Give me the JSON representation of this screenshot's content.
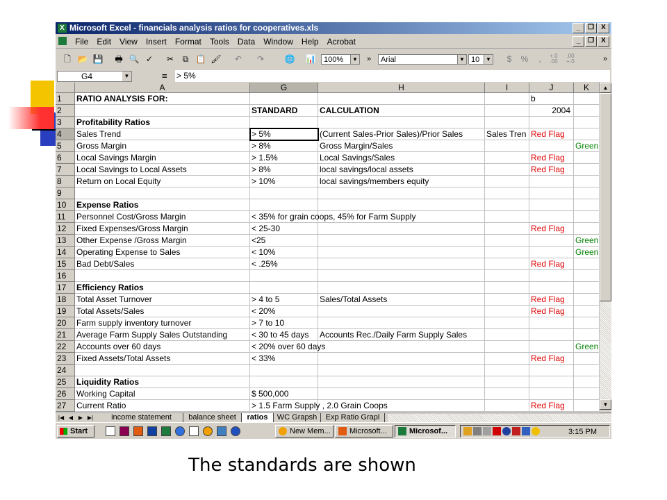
{
  "window": {
    "title": "Microsoft Excel - financials analysis ratios for cooperatives.xls",
    "app_icon": "excel-icon",
    "controls": [
      "_",
      "❐",
      "X"
    ]
  },
  "menubar": {
    "items": [
      "File",
      "Edit",
      "View",
      "Insert",
      "Format",
      "Tools",
      "Data",
      "Window",
      "Help",
      "Acrobat"
    ],
    "doc_controls": [
      "_",
      "❐",
      "X"
    ]
  },
  "toolbar": {
    "zoom": "100%",
    "font_name": "Arial",
    "font_size": "10",
    "more": "»",
    "currency": "$",
    "percent": "%",
    "comma": ",",
    "inc_decimal": "+.0\n.00",
    "dec_decimal": ".00\n+.0"
  },
  "formula_bar": {
    "name_box": "G4",
    "equals": "=",
    "value": "> 5%"
  },
  "columns": [
    {
      "label": "A",
      "selected": false
    },
    {
      "label": "G",
      "selected": true
    },
    {
      "label": "H",
      "selected": false
    },
    {
      "label": "I",
      "selected": false
    },
    {
      "label": "J",
      "selected": false
    },
    {
      "label": "K",
      "selected": false
    }
  ],
  "rows": [
    {
      "num": "1",
      "A": "RATIO ANALYSIS FOR:",
      "A_bold": true,
      "G": "",
      "H": "",
      "I": "",
      "J": "b",
      "K": ""
    },
    {
      "num": "2",
      "A": "",
      "G": "STANDARD",
      "G_bold": true,
      "H": "CALCULATION",
      "H_bold": true,
      "I": "",
      "J": "2004",
      "J_right": true,
      "K": ""
    },
    {
      "num": "3",
      "A": "Profitability Ratios",
      "A_bold": true,
      "G": "",
      "H": "",
      "I": "",
      "J": "",
      "K": ""
    },
    {
      "num": "4",
      "A": "Sales Trend",
      "G": "> 5%",
      "H": "(Current Sales-Prior Sales)/Prior Sales",
      "I": "Sales Tren",
      "J": "Red Flag",
      "J_color": "red",
      "K": ""
    },
    {
      "num": "5",
      "A": "Gross Margin",
      "G": "> 8%",
      "H": "Gross Margin/Sales",
      "I": "",
      "J": "",
      "K": "Green",
      "K_color": "green"
    },
    {
      "num": "6",
      "A": "Local Savings Margin",
      "G": "> 1.5%",
      "H": "Local Savings/Sales",
      "I": "",
      "J": "Red Flag",
      "J_color": "red",
      "K": ""
    },
    {
      "num": "7",
      "A": "Local Savings to Local Assets",
      "G": "> 8%",
      "H": "local savings/local assets",
      "I": "",
      "J": "Red Flag",
      "J_color": "red",
      "K": ""
    },
    {
      "num": "8",
      "A": "Return on Local Equity",
      "G": "> 10%",
      "H": "local savings/members equity",
      "I": "",
      "J": "",
      "K": ""
    },
    {
      "num": "9",
      "A": "",
      "G": "",
      "H": "",
      "I": "",
      "J": "",
      "K": ""
    },
    {
      "num": "10",
      "A": "Expense Ratios",
      "A_bold": true,
      "G": "",
      "H": "",
      "I": "",
      "J": "",
      "K": ""
    },
    {
      "num": "11",
      "A": "Personnel Cost/Gross Margin",
      "G": "< 35% for grain coops, 45% for Farm Supply",
      "G_overflow": true,
      "H": "",
      "I": "",
      "J": "",
      "K": ""
    },
    {
      "num": "12",
      "A": "Fixed Expenses/Gross Margin",
      "G": "< 25-30",
      "H": "",
      "I": "",
      "J": "Red Flag",
      "J_color": "red",
      "K": ""
    },
    {
      "num": "13",
      "A": "Other Expense /Gross Margin",
      "G": "<25",
      "H": "",
      "I": "",
      "J": "",
      "K": "Green",
      "K_color": "green"
    },
    {
      "num": "14",
      "A": "Operating Expense to Sales",
      "G": "< 10%",
      "H": "",
      "I": "",
      "J": "",
      "K": "Green",
      "K_color": "green"
    },
    {
      "num": "15",
      "A": "Bad Debt/Sales",
      "G": "< .25%",
      "H": "",
      "I": "",
      "J": "Red Flag",
      "J_color": "red",
      "K": ""
    },
    {
      "num": "16",
      "A": "",
      "G": "",
      "H": "",
      "I": "",
      "J": "",
      "K": ""
    },
    {
      "num": "17",
      "A": "Efficiency Ratios",
      "A_bold": true,
      "G": "",
      "H": "",
      "I": "",
      "J": "",
      "K": ""
    },
    {
      "num": "18",
      "A": "Total Asset Turnover",
      "G": " > 4 to 5",
      "H": "Sales/Total Assets",
      "I": "",
      "J": "Red Flag",
      "J_color": "red",
      "K": ""
    },
    {
      "num": "19",
      "A": "Total Assets/Sales",
      "G": "< 20%",
      "H": "",
      "I": "",
      "J": "Red Flag",
      "J_color": "red",
      "K": ""
    },
    {
      "num": "20",
      "A": "Farm supply inventory turnover",
      "G": "> 7 to 10",
      "H": "",
      "I": "",
      "J": "",
      "K": ""
    },
    {
      "num": "21",
      "A": "Average Farm Supply Sales Outstanding",
      "G": "< 30 to 45 days",
      "H": "Accounts Rec./Daily Farm Supply Sales",
      "I": "",
      "J": "",
      "K": ""
    },
    {
      "num": "22",
      "A": "Accounts over 60 days",
      "G": "< 20% over 60 days",
      "G_overflow": true,
      "H": "",
      "I": "",
      "J": "",
      "K": "Green",
      "K_color": "green"
    },
    {
      "num": "23",
      "A": "Fixed Assets/Total Assets",
      "G": "< 33%",
      "H": "",
      "I": "",
      "J": "Red Flag",
      "J_color": "red",
      "K": ""
    },
    {
      "num": "24",
      "A": "",
      "G": "",
      "H": "",
      "I": "",
      "J": "",
      "K": ""
    },
    {
      "num": "25",
      "A": "Liquidity Ratios",
      "A_bold": true,
      "G": "",
      "H": "",
      "I": "",
      "J": "",
      "K": ""
    },
    {
      "num": "26",
      "A": "Working Capital",
      "G": " $        500,000",
      "H": "",
      "I": "",
      "J": "",
      "K": ""
    },
    {
      "num": "27",
      "A": "Current Ratio",
      "G": "> 1.5 Farm Supply , 2.0 Grain Coops",
      "G_overflow": true,
      "H": "",
      "I": "",
      "J": "Red Flag",
      "J_color": "red",
      "K": ""
    }
  ],
  "sheet_tabs": [
    {
      "label": "income statement",
      "active": false
    },
    {
      "label": "balance sheet",
      "active": false
    },
    {
      "label": "ratios",
      "active": true
    },
    {
      "label": "WC Grapsh",
      "active": false
    },
    {
      "label": "Exp Ratio Grapl",
      "active": false
    }
  ],
  "taskbar": {
    "start": "Start",
    "items": [
      {
        "label": "New Mem...",
        "active": false
      },
      {
        "label": "Microsoft...",
        "active": false
      },
      {
        "label": "Microsof...",
        "active": true
      }
    ],
    "clock": "3:15 PM"
  },
  "caption": "The standards are shown",
  "colors": {
    "titlebar_start": "#0a246a",
    "titlebar_end": "#a6caf0",
    "red_flag": "#e00000",
    "green": "#008000",
    "chrome": "#d4d0c8"
  }
}
